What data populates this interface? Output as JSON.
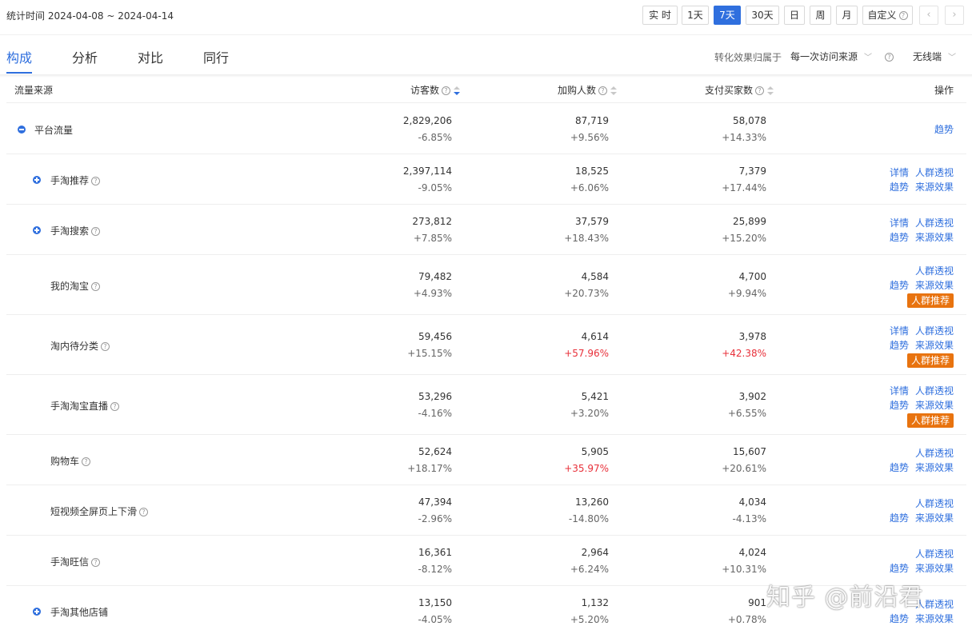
{
  "header": {
    "date_range": "统计时间 2024-04-08 ~ 2024-04-14",
    "periods": [
      "实 时",
      "1天",
      "7天",
      "30天",
      "日",
      "周",
      "月",
      "自定义"
    ],
    "active_period": "7天",
    "prev": "‹",
    "next": "›"
  },
  "tabs": [
    "构成",
    "分析",
    "对比",
    "同行"
  ],
  "active_tab": "构成",
  "attribution": {
    "label": "转化效果归属于",
    "value": "每一次访问来源",
    "device": "无线端"
  },
  "table": {
    "columns": {
      "source": "流量来源",
      "visitors": "访客数",
      "cart": "加购人数",
      "buyers": "支付买家数",
      "actions": "操作"
    },
    "rows": [
      {
        "name": "平台流量",
        "visitors": "2,829,206",
        "visitors_chg": "-6.85%",
        "cart": "87,719",
        "cart_chg": "+9.56%",
        "buyers": "58,078",
        "buyers_chg": "+14.33%",
        "actions": [
          [
            "趋势"
          ]
        ]
      },
      {
        "name": "手淘推荐",
        "visitors": "2,397,114",
        "visitors_chg": "-9.05%",
        "cart": "18,525",
        "cart_chg": "+6.06%",
        "buyers": "7,379",
        "buyers_chg": "+17.44%",
        "actions": [
          [
            "详情",
            "人群透视"
          ],
          [
            "趋势",
            "来源效果"
          ]
        ]
      },
      {
        "name": "手淘搜索",
        "visitors": "273,812",
        "visitors_chg": "+7.85%",
        "cart": "37,579",
        "cart_chg": "+18.43%",
        "buyers": "25,899",
        "buyers_chg": "+15.20%",
        "actions": [
          [
            "详情",
            "人群透视"
          ],
          [
            "趋势",
            "来源效果"
          ]
        ]
      },
      {
        "name": "我的淘宝",
        "visitors": "79,482",
        "visitors_chg": "+4.93%",
        "cart": "4,584",
        "cart_chg": "+20.73%",
        "buyers": "4,700",
        "buyers_chg": "+9.94%",
        "actions": [
          [
            "人群透视"
          ],
          [
            "趋势",
            "来源效果"
          ]
        ],
        "badge": "人群推荐"
      },
      {
        "name": "淘内待分类",
        "visitors": "59,456",
        "visitors_chg": "+15.15%",
        "cart": "4,614",
        "cart_chg": "+57.96%",
        "buyers": "3,978",
        "buyers_chg": "+42.38%",
        "actions": [
          [
            "详情",
            "人群透视"
          ],
          [
            "趋势",
            "来源效果"
          ]
        ],
        "badge": "人群推荐"
      },
      {
        "name": "手淘淘宝直播",
        "visitors": "53,296",
        "visitors_chg": "-4.16%",
        "cart": "5,421",
        "cart_chg": "+3.20%",
        "buyers": "3,902",
        "buyers_chg": "+6.55%",
        "actions": [
          [
            "详情",
            "人群透视"
          ],
          [
            "趋势",
            "来源效果"
          ]
        ],
        "badge": "人群推荐"
      },
      {
        "name": "购物车",
        "visitors": "52,624",
        "visitors_chg": "+18.17%",
        "cart": "5,905",
        "cart_chg": "+35.97%",
        "buyers": "15,607",
        "buyers_chg": "+20.61%",
        "actions": [
          [
            "人群透视"
          ],
          [
            "趋势",
            "来源效果"
          ]
        ]
      },
      {
        "name": "短视频全屏页上下滑",
        "visitors": "47,394",
        "visitors_chg": "-2.96%",
        "cart": "13,260",
        "cart_chg": "-14.80%",
        "buyers": "4,034",
        "buyers_chg": "-4.13%",
        "actions": [
          [
            "人群透视"
          ],
          [
            "趋势",
            "来源效果"
          ]
        ]
      },
      {
        "name": "手淘旺信",
        "visitors": "16,361",
        "visitors_chg": "-8.12%",
        "cart": "2,964",
        "cart_chg": "+6.24%",
        "buyers": "4,024",
        "buyers_chg": "+10.31%",
        "actions": [
          [
            "人群透视"
          ],
          [
            "趋势",
            "来源效果"
          ]
        ]
      },
      {
        "name": "手淘其他店铺",
        "visitors": "13,150",
        "visitors_chg": "-4.05%",
        "cart": "1,132",
        "cart_chg": "+5.20%",
        "buyers": "901",
        "buyers_chg": "+0.78%",
        "actions": [
          [
            "人群透视"
          ],
          [
            "趋势",
            "来源效果"
          ]
        ]
      }
    ]
  },
  "watermark": "知乎 @前沿君",
  "colors": {
    "accent": "#2f6fde",
    "negative_highlight": "#e8303a",
    "badge": "#e8730f"
  }
}
